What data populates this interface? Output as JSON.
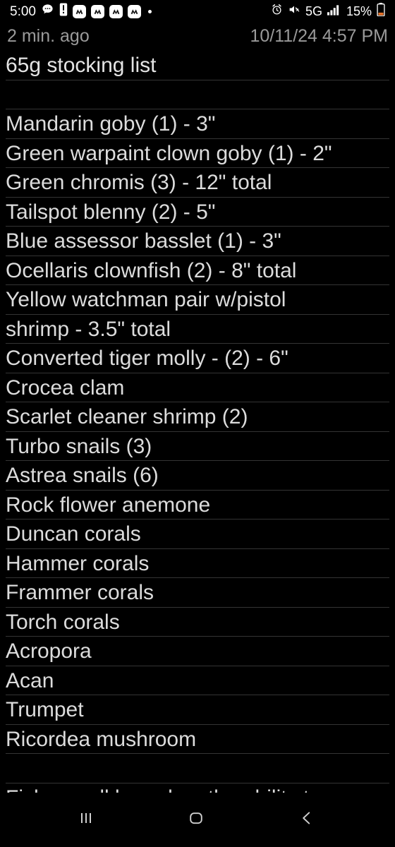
{
  "status_bar": {
    "clock": "5:00",
    "left_icons": [
      "message-bubble-icon",
      "alert-priority-icon",
      "app-badge-icon",
      "app-badge-icon",
      "app-badge-icon",
      "app-badge-icon",
      "more-notifications-dot-icon"
    ],
    "right_icons": [
      "alarm-clock-icon",
      "sound-mute-icon",
      "signal-bars-icon",
      "battery-icon"
    ],
    "network_type": "5G",
    "battery_percent": "15%",
    "battery_color": "#e8732a"
  },
  "meta": {
    "relative_time": "2 min. ago",
    "timestamp": "10/11/24 4:57 PM"
  },
  "note": {
    "title": "65g stocking list",
    "lines": [
      "65g stocking list",
      "",
      "Mandarin goby (1) - 3\"",
      "Green warpaint clown goby (1) - 2\"",
      "Green chromis (3) - 12\" total",
      "Tailspot blenny (2) - 5\"",
      "Blue assessor basslet (1) - 3\"",
      "Ocellaris clownfish (2) - 8\" total",
      "Yellow watchman pair w/pistol",
      "shrimp - 3.5\" total",
      "Converted tiger molly - (2) - 6\"",
      "Crocea clam",
      "Scarlet cleaner shrimp (2)",
      "Turbo snails (3)",
      "Astrea snails (6)",
      "Rock flower anemone",
      "Duncan corals",
      "Hammer corals",
      "Frammer corals",
      "Torch corals",
      "Acropora",
      "Acan",
      "Trumpet",
      "Ricordea mushroom",
      "",
      "Fish are all based on the ability t"
    ],
    "rule_color": "#343434",
    "text_color": "#dcdcdc",
    "background_color": "#000000"
  },
  "navigation_bar": {
    "buttons": [
      {
        "name": "recents-button",
        "icon": "recents-icon"
      },
      {
        "name": "home-button",
        "icon": "home-icon"
      },
      {
        "name": "back-button",
        "icon": "back-chevron-icon"
      }
    ]
  }
}
